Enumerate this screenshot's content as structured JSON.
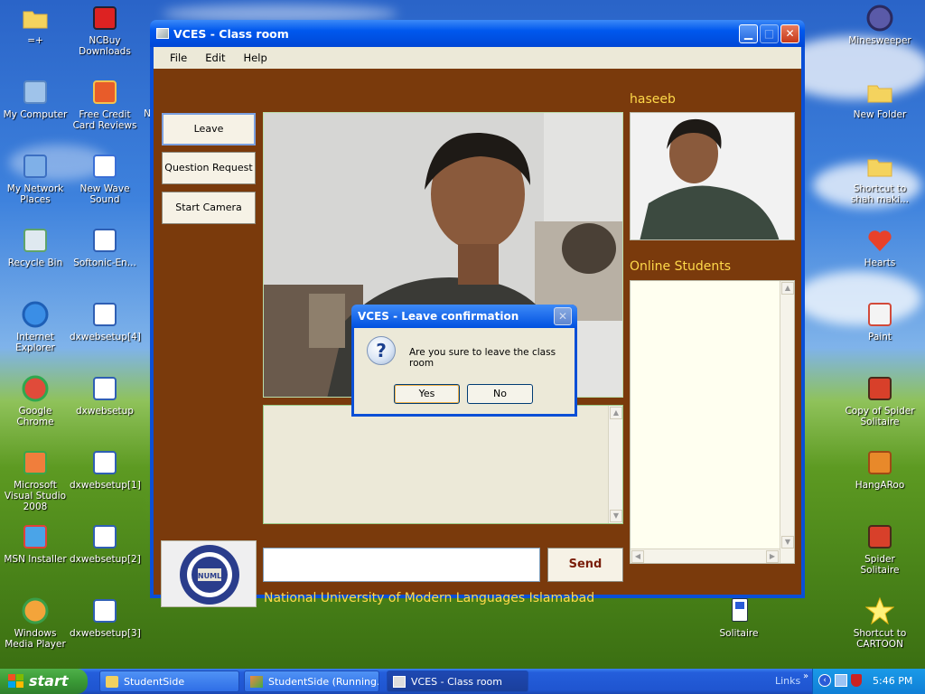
{
  "desktop": {
    "icons_left": [
      {
        "label": "=+",
        "icon": "folder-icon"
      },
      {
        "label": "My Computer",
        "icon": "computer-icon"
      },
      {
        "label": "My Network Places",
        "icon": "network-icon"
      },
      {
        "label": "Recycle Bin",
        "icon": "recycle-bin-icon"
      },
      {
        "label": "Internet Explorer",
        "icon": "ie-icon"
      },
      {
        "label": "Google Chrome",
        "icon": "chrome-icon"
      },
      {
        "label": "Microsoft Visual Studio 2008",
        "icon": "visual-studio-icon"
      },
      {
        "label": "MSN Installer",
        "icon": "msn-icon"
      },
      {
        "label": "Windows Media Player",
        "icon": "media-player-icon"
      }
    ],
    "icons_col2": [
      {
        "label": "NCBuy Downloads",
        "icon": "ncbuy-icon"
      },
      {
        "label": "Free Credit Card Reviews",
        "icon": "credit-card-icon"
      },
      {
        "label": "New Wave Sound",
        "icon": "wave-sound-icon"
      },
      {
        "label": "Softonic-En...",
        "icon": "installer-icon"
      },
      {
        "label": "dxwebsetup[4]",
        "icon": "installer-icon"
      },
      {
        "label": "dxwebsetup",
        "icon": "installer-icon"
      },
      {
        "label": "dxwebsetup[1]",
        "icon": "installer-icon"
      },
      {
        "label": "dxwebsetup[2]",
        "icon": "installer-icon"
      },
      {
        "label": "dxwebsetup[3]",
        "icon": "installer-icon"
      }
    ],
    "icons_right": [
      {
        "label": "Minesweeper",
        "icon": "minesweeper-icon"
      },
      {
        "label": "New Folder",
        "icon": "folder-icon"
      },
      {
        "label": "Shortcut to shah maki...",
        "icon": "folder-icon"
      },
      {
        "label": "Hearts",
        "icon": "hearts-icon"
      },
      {
        "label": "Paint",
        "icon": "paint-icon"
      },
      {
        "label": "Copy of Spider Solitaire",
        "icon": "spider-icon"
      },
      {
        "label": "HangARoo",
        "icon": "hangaroo-icon"
      },
      {
        "label": "Spider Solitaire",
        "icon": "spider-icon"
      },
      {
        "label": "Shortcut to CARTOON",
        "icon": "star-icon"
      }
    ],
    "solitaire": {
      "label": "Solitaire",
      "icon": "solitaire-icon"
    },
    "partial_label": "N"
  },
  "window": {
    "title": "VCES - Class room",
    "menu": [
      "File",
      "Edit",
      "Help"
    ],
    "buttons": {
      "leave": "Leave",
      "question": "Question Request",
      "camera": "Start Camera",
      "send": "Send"
    },
    "teacher_name": "haseeb",
    "online_students_label": "Online Students",
    "university": "National University of Modern Languages Islamabad",
    "logo_text": "NATIONAL UNIVERSITY OF MODERN LANGUAGES",
    "logo_mark": "NUML",
    "message_value": ""
  },
  "dialog": {
    "title": "VCES - Leave confirmation",
    "message": "Are you sure to leave the class room",
    "yes": "Yes",
    "no": "No"
  },
  "taskbar": {
    "start": "start",
    "tasks": [
      {
        "label": "StudentSide"
      },
      {
        "label": "StudentSide (Running..."
      },
      {
        "label": "VCES - Class room"
      }
    ],
    "links": "Links",
    "time": "5:46 PM"
  }
}
